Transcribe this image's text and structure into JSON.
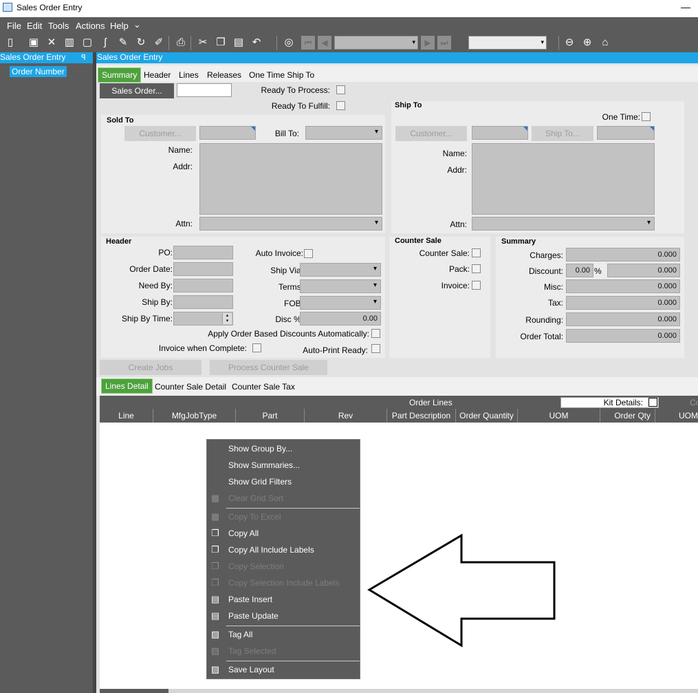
{
  "window": {
    "title": "Sales Order Entry",
    "minimize": "—"
  },
  "menu": {
    "items": [
      "File",
      "Edit",
      "Tools",
      "Actions",
      "Help"
    ],
    "more": "⌄"
  },
  "toolbar": {
    "icons": [
      "new-icon",
      "save-icon",
      "delete-icon",
      "book-icon",
      "note-icon",
      "phone-icon",
      "attach-icon",
      "refresh-icon",
      "clear-icon",
      "print-icon",
      "cut-icon",
      "copy-icon",
      "paste-icon",
      "undo-icon",
      "binoculars-icon",
      "first-icon",
      "prev-icon",
      "next-icon",
      "last-icon",
      "back-icon",
      "forward-icon",
      "home-icon"
    ],
    "nav_combo_value": "",
    "second_combo_value": ""
  },
  "tree": {
    "header": "Sales Order Entry",
    "pin": "ꟼ",
    "node": "Order Number"
  },
  "main": {
    "header": "Sales Order Entry"
  },
  "tabs": {
    "items": [
      "Summary",
      "Header",
      "Lines",
      "Releases",
      "One Time Ship To"
    ],
    "active": "Summary"
  },
  "summary": {
    "sales_order_button": "Sales Order...",
    "sales_order_value": "",
    "ready_to_process": "Ready To Process:",
    "ready_to_fulfill": "Ready To Fulfill:",
    "sold_to": {
      "title": "Sold To",
      "customer_button": "Customer...",
      "bill_to": "Bill To:",
      "name": "Name:",
      "addr": "Addr:",
      "attn": "Attn:"
    },
    "ship_to": {
      "title": "Ship To",
      "one_time": "One Time:",
      "customer_button": "Customer...",
      "ship_to_button": "Ship To...",
      "name": "Name:",
      "addr": "Addr:",
      "attn": "Attn:"
    },
    "header": {
      "title": "Header",
      "po": "PO:",
      "order_date": "Order Date:",
      "need_by": "Need By:",
      "ship_by": "Ship By:",
      "ship_by_time": "Ship By Time:",
      "auto_invoice": "Auto Invoice:",
      "ship_via": "Ship Via:",
      "terms": "Terms:",
      "fob": "FOB:",
      "disc_pct": "Disc %:",
      "disc_pct_value": "0.00",
      "apply_discounts": "Apply Order Based Discounts Automatically:",
      "invoice_when_complete": "Invoice when Complete:",
      "auto_print_ready": "Auto-Print Ready:"
    },
    "counter_sale": {
      "title": "Counter Sale",
      "counter_sale": "Counter Sale:",
      "pack": "Pack:",
      "invoice": "Invoice:"
    },
    "totals": {
      "title": "Summary",
      "charges": "Charges:",
      "charges_value": "0.000",
      "discount": "Discount:",
      "discount_pct_value": "0.00",
      "discount_pct_sign": "%",
      "discount_value": "0.000",
      "misc": "Misc:",
      "misc_value": "0.000",
      "tax": "Tax:",
      "tax_value": "0.000",
      "rounding": "Rounding:",
      "rounding_value": "0.000",
      "order_total": "Order Total:",
      "order_total_value": "0.000"
    },
    "create_jobs_button": "Create Jobs",
    "process_counter_sale_button": "Process Counter Sale"
  },
  "lower_tabs": {
    "items": [
      "Lines Detail",
      "Counter Sale Detail",
      "Counter Sale Tax"
    ],
    "active": "Lines Detail"
  },
  "grid": {
    "title": "Order Lines",
    "kit_details": "Kit Details:",
    "overflow_header": "Co",
    "columns": [
      "Line",
      "MfgJobType",
      "Part",
      "Rev",
      "Part Description",
      "Order Quantity",
      "UOM",
      "Order Qty",
      "UOM"
    ]
  },
  "context_menu": {
    "items": [
      {
        "label": "Show Group By...",
        "icon": "",
        "enabled": true
      },
      {
        "label": "Show Summaries...",
        "icon": "",
        "enabled": true
      },
      {
        "label": "Show Grid Filters",
        "icon": "",
        "enabled": true
      },
      {
        "label": "Clear Grid Sort",
        "icon": "sort-icon",
        "enabled": false
      },
      {
        "label": "Copy To Excel",
        "icon": "excel-icon",
        "enabled": false
      },
      {
        "label": "Copy All",
        "icon": "copy-icon",
        "enabled": true
      },
      {
        "label": "Copy All Include Labels",
        "icon": "copy-icon",
        "enabled": true
      },
      {
        "label": "Copy Selection",
        "icon": "copy-icon",
        "enabled": false
      },
      {
        "label": "Copy Selection Include Labels",
        "icon": "copy-icon",
        "enabled": false
      },
      {
        "label": "Paste Insert",
        "icon": "paste-icon",
        "enabled": true
      },
      {
        "label": "Paste Update",
        "icon": "paste-icon",
        "enabled": true
      },
      {
        "label": "Tag All",
        "icon": "tag-icon",
        "enabled": true
      },
      {
        "label": "Tag Selected",
        "icon": "tag-icon",
        "enabled": false
      },
      {
        "label": "Save Layout",
        "icon": "layout-icon",
        "enabled": true
      }
    ]
  },
  "colors": {
    "accent": "#1ea5e6",
    "active_tab": "#4ea13d",
    "toolbar": "#5b5b5b",
    "field": "#c2c2c2"
  }
}
